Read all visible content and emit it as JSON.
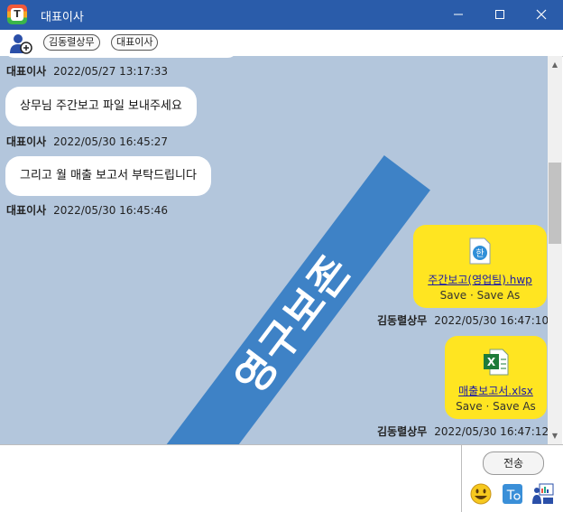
{
  "window": {
    "title": "대표이사",
    "app_logo_letter": "T"
  },
  "participants": [
    "김동렬상무",
    "대표이사"
  ],
  "messages": [
    {
      "sender": "대표이사",
      "time": "2022/05/27 13:17:33"
    },
    {
      "text": "상무님 주간보고 파일 보내주세요",
      "sender": "대표이사",
      "time": "2022/05/30 16:45:27"
    },
    {
      "text": "그리고 월 매출 보고서 부탁드립니다",
      "sender": "대표이사",
      "time": "2022/05/30 16:45:46"
    }
  ],
  "files": [
    {
      "name": "주간보고(영업팀).hwp",
      "actions": "Save · Save As",
      "sender": "김동렬상무",
      "time": "2022/05/30 16:47:10",
      "icon": "hwp-file-icon"
    },
    {
      "name": "매출보고서.xlsx",
      "actions": "Save · Save As",
      "sender": "김동렬상무",
      "time": "2022/05/30 16:47:12",
      "icon": "excel-file-icon"
    }
  ],
  "banner": "영구보존",
  "composer": {
    "send_label": "전송"
  },
  "colors": {
    "titlebar": "#2a5caa",
    "chat_bg": "#b3c6dc",
    "file_bubble": "#ffe521",
    "banner": "#3e82c6"
  }
}
